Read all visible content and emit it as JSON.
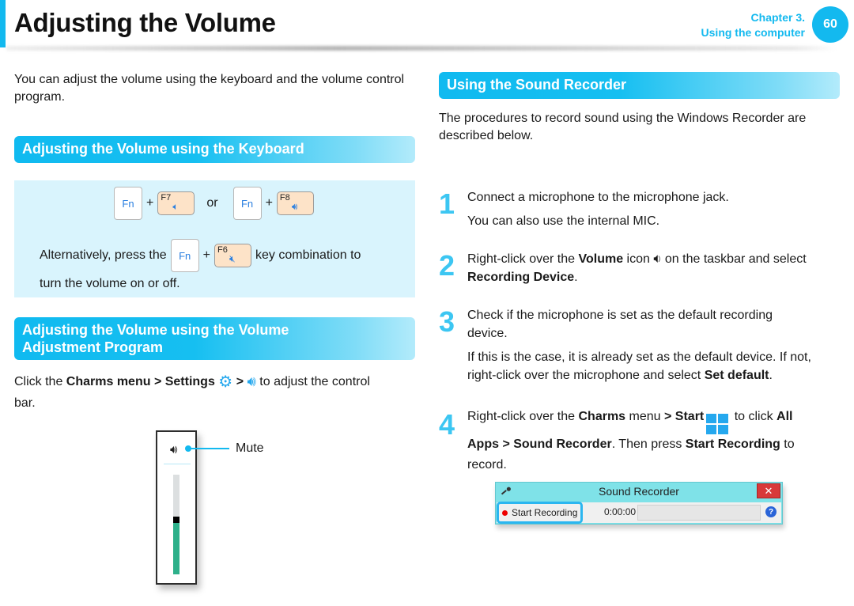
{
  "header": {
    "title": "Adjusting the Volume",
    "chapter": "Chapter 3.",
    "chapter_name": "Using the computer",
    "page_number": "60"
  },
  "intro": "You can adjust the volume using the keyboard and the volume control program.",
  "keyboard_section": {
    "heading": "Adjusting the Volume using the Keyboard",
    "fn_label": "Fn",
    "plus": "+",
    "or": "or",
    "f7_label": "F7",
    "f8_label": "F8",
    "f6_label": "F6",
    "f7_icon": "volume-down-icon",
    "f8_icon": "volume-up-icon",
    "f6_icon": "mute-icon",
    "alt_text_before": "Alternatively, press the",
    "alt_text_after": "key combination to",
    "alt_text_line2": "turn the volume on or off."
  },
  "program_section": {
    "heading_line1": "Adjusting the Volume using the Volume",
    "heading_line2": "Adjustment Program",
    "text_before": "Click the ",
    "charms": "Charms menu > Settings",
    "separator": ">",
    "text_after": "to adjust the control",
    "text_line2": "bar.",
    "mute_label": "Mute",
    "volume_level": 0.55
  },
  "recorder_section": {
    "heading": "Using the Sound Recorder",
    "intro": "The procedures to record sound using the Windows Recorder are described below.",
    "steps": [
      {
        "num": "1",
        "line1": "Connect a microphone to the microphone jack.",
        "line2": "You can also use the internal MIC."
      },
      {
        "num": "2",
        "a": "Right-click over the ",
        "b": "Volume",
        "c": " icon ",
        "d": " on the taskbar and select ",
        "e": "Recording Device",
        "f": "."
      },
      {
        "num": "3",
        "line1": "Check if the microphone is set as the default recording device.",
        "line2_a": "If this is the case, it is already set as the default device. If not, right-click over the microphone and select ",
        "line2_b": "Set default",
        "line2_c": "."
      },
      {
        "num": "4",
        "a": "Right-click over the ",
        "b": "Charms",
        "c": " menu ",
        "d": "> Start",
        "e": " to click ",
        "f": "All Apps > Sound Recorder",
        "g": ". Then press ",
        "h": "Start Recording",
        "i": " to record."
      }
    ]
  },
  "sound_recorder": {
    "title": "Sound Recorder",
    "close": "✕",
    "start_button": "Start Recording",
    "time": "0:00:00",
    "help": "?"
  }
}
